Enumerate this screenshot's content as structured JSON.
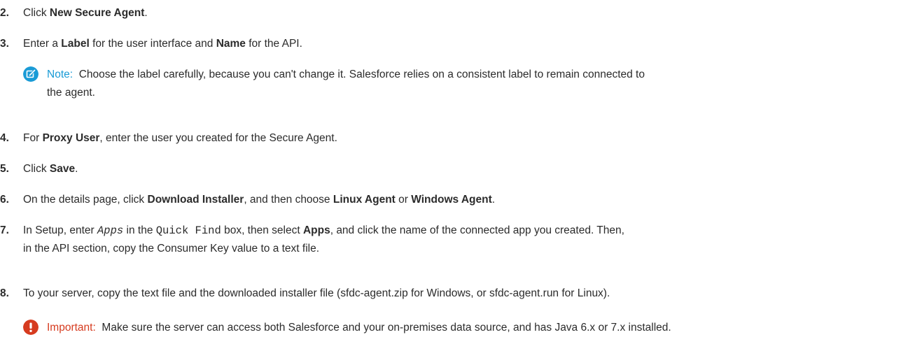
{
  "steps": [
    {
      "num": "2.",
      "t1": "Click ",
      "b1": "New Secure Agent",
      "t2": "."
    },
    {
      "num": "3.",
      "t1": "Enter a ",
      "b1": "Label",
      "t2": " for the user interface and ",
      "b2": "Name",
      "t3": " for the API."
    },
    {
      "num": "4.",
      "t1": "For ",
      "b1": "Proxy User",
      "t2": ", enter the user you created for the Secure Agent."
    },
    {
      "num": "5.",
      "t1": "Click ",
      "b1": "Save",
      "t2": "."
    },
    {
      "num": "6.",
      "t1": "On the details page, click ",
      "b1": "Download Installer",
      "t2": ", and then choose ",
      "b2": "Linux Agent",
      "t3": " or ",
      "b3": "Windows Agent",
      "t4": "."
    },
    {
      "num": "7.",
      "t1": "In Setup, enter ",
      "c1": "Apps",
      "t2": " in the ",
      "c2": "Quick Find",
      "t3": " box, then select ",
      "b1": "Apps",
      "t4": ", and click the name of the connected app you created. Then,",
      "line2": "in the API section, copy the Consumer Key value to a text file."
    },
    {
      "num": "8.",
      "t1": "To your server, copy the text file and the downloaded installer file (sfdc-agent.zip for Windows, or sfdc-agent.run for Linux)."
    }
  ],
  "note": {
    "icon": "note-edit-icon",
    "label": "Note:",
    "text": "Choose the label carefully, because you can't change it. Salesforce relies on a consistent label to remain connected to",
    "text2": "the agent."
  },
  "important": {
    "icon": "warning-icon",
    "label": "Important:",
    "text": "Make sure the server can access both Salesforce and your on-premises data source, and has Java 6.x or 7.x installed."
  },
  "colors": {
    "note_accent": "#1a9bd6",
    "important_accent": "#d63b1f",
    "text": "#2b2b2b"
  }
}
